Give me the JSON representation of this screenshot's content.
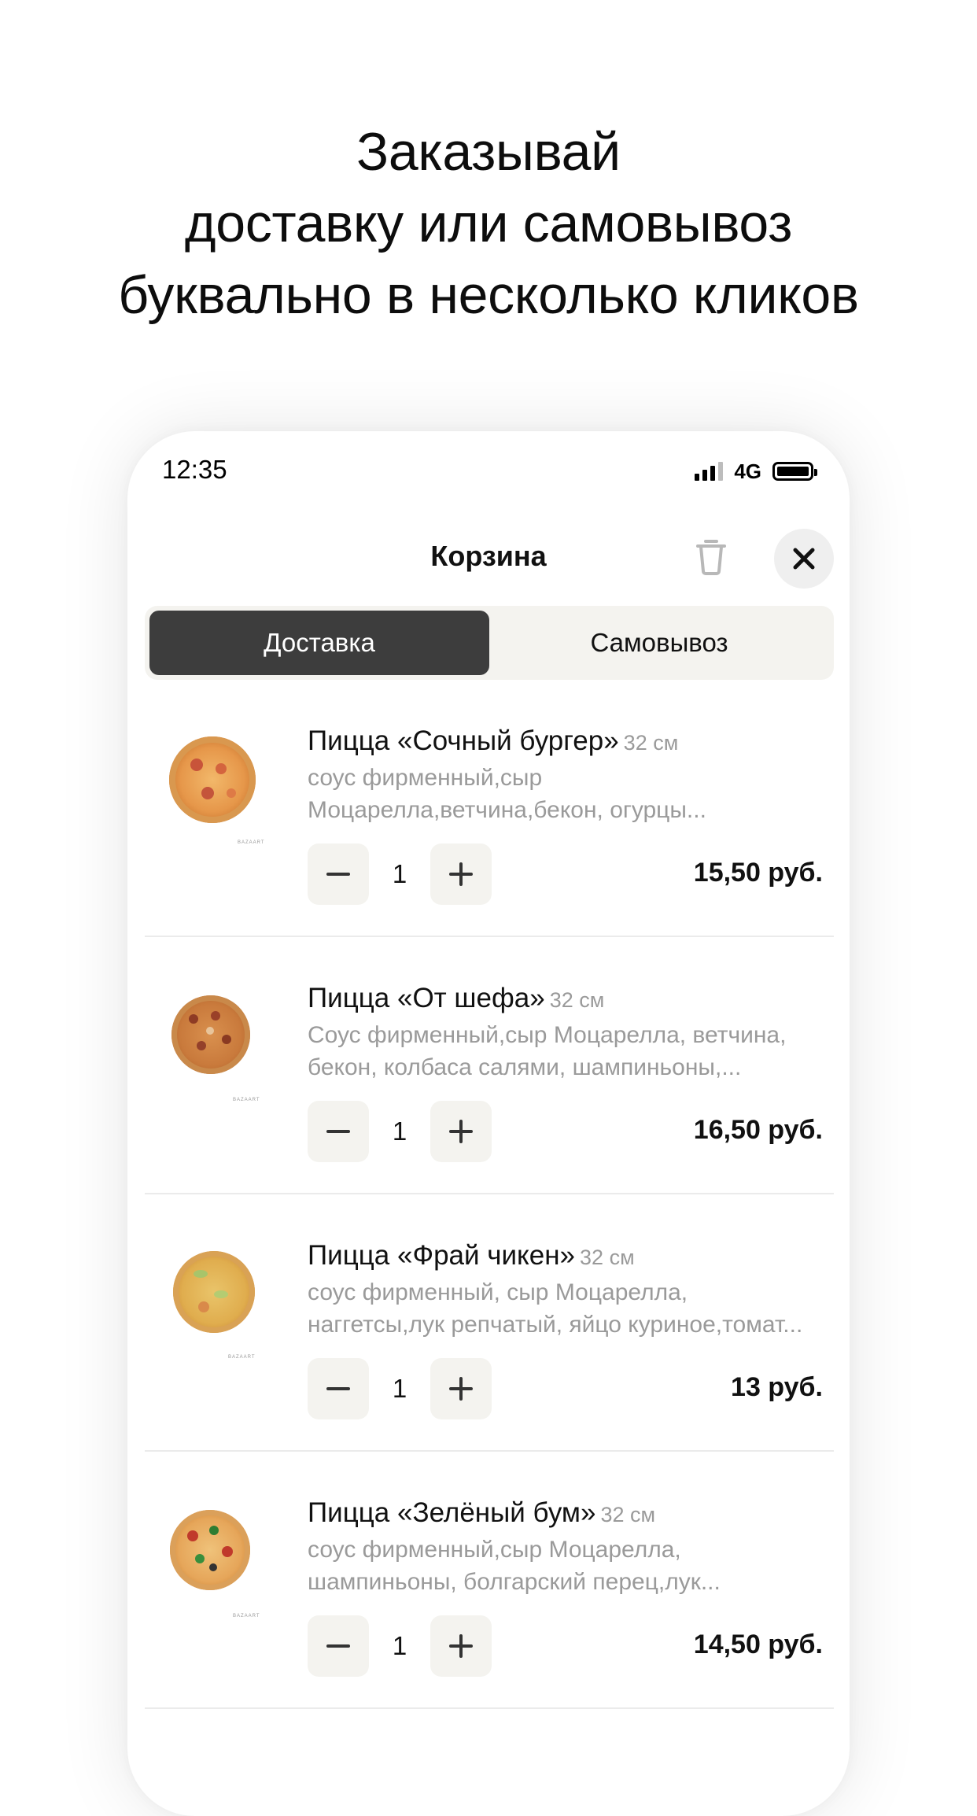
{
  "headline": {
    "lines": [
      "Заказывай",
      "доставку или самовывоз",
      "буквально в несколько кликов"
    ]
  },
  "status_bar": {
    "time": "12:35",
    "network": "4G"
  },
  "header": {
    "title": "Корзина",
    "icons": [
      "trash-icon",
      "close-icon"
    ]
  },
  "segmented": {
    "options": [
      "Доставка",
      "Самовывоз"
    ],
    "selected": "Доставка"
  },
  "cart": {
    "items": [
      {
        "name": "Пицца «Сочный бургер»",
        "size": "32 см",
        "desc": [
          "соус фирменный,сыр",
          "Моцарелла,ветчина,бекон, огурцы..."
        ],
        "qty": "1",
        "price": "15,50 руб.",
        "brand": "BAZAART"
      },
      {
        "name": "Пицца «От шефа»",
        "size": "32 см",
        "desc": [
          "Соус фирменный,сыр Моцарелла, ветчина,",
          "бекон, колбаса салями, шампиньоны,..."
        ],
        "qty": "1",
        "price": "16,50 руб.",
        "brand": "BAZAART"
      },
      {
        "name": "Пицца «Фрай чикен»",
        "size": "32 см",
        "desc": [
          "соус фирменный, сыр Моцарелла,",
          "наггетсы,лук репчатый, яйцо куриное,томат..."
        ],
        "qty": "1",
        "price": "13 руб.",
        "brand": "BAZAART"
      },
      {
        "name": "Пицца «Зелёный бум»",
        "size": "32 см",
        "desc": [
          "соус фирменный,сыр Моцарелла,",
          "шампиньоны, болгарский перец,лук..."
        ],
        "qty": "1",
        "price": "14,50 руб.",
        "brand": "BAZAART"
      }
    ]
  },
  "colors": {
    "segment_active_bg": "#3d3d3d",
    "segment_bg": "#f4f3ef",
    "muted_text": "#9a9a9a"
  }
}
